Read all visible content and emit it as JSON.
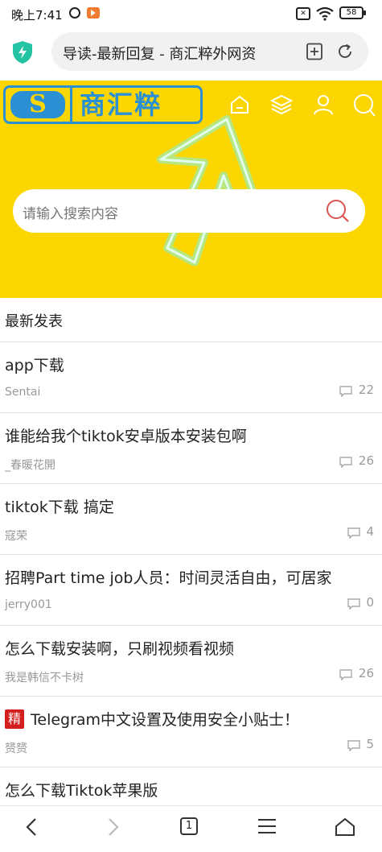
{
  "status_bar": {
    "time": "晚上7:41",
    "sim_label": "✕",
    "battery": "58"
  },
  "browser": {
    "address_text": "导读-最新回复 - 商汇粹外网资"
  },
  "site": {
    "logo_letter": "S",
    "logo_text": "商汇粹",
    "brand_color": "#fcd600",
    "accent_color": "#2a8fd3",
    "search_placeholder": "请输入搜索内容"
  },
  "section_title": "最新发表",
  "posts": [
    {
      "title": "app下载",
      "author": "Sentai",
      "comments": "22",
      "tag": ""
    },
    {
      "title": "谁能给我个tiktok安卓版本安装包啊",
      "author": "_春暖花開",
      "comments": "26",
      "tag": ""
    },
    {
      "title": "tiktok下载 搞定",
      "author": "寇荣",
      "comments": "4",
      "tag": ""
    },
    {
      "title": "招聘Part time job人员：时间灵活自由，可居家",
      "author": "jerry001",
      "comments": "0",
      "tag": ""
    },
    {
      "title": "怎么下载安装啊，只刷视频看视频",
      "author": "我是韩信不卡树",
      "comments": "26",
      "tag": ""
    },
    {
      "title": "Telegram中文设置及使用安全小贴士！",
      "author": "赟赟",
      "comments": "5",
      "tag": "精"
    },
    {
      "title": "怎么下载Tiktok苹果版",
      "author": "",
      "comments": "",
      "tag": ""
    }
  ],
  "bottom_nav": {
    "tab_count": "1"
  }
}
